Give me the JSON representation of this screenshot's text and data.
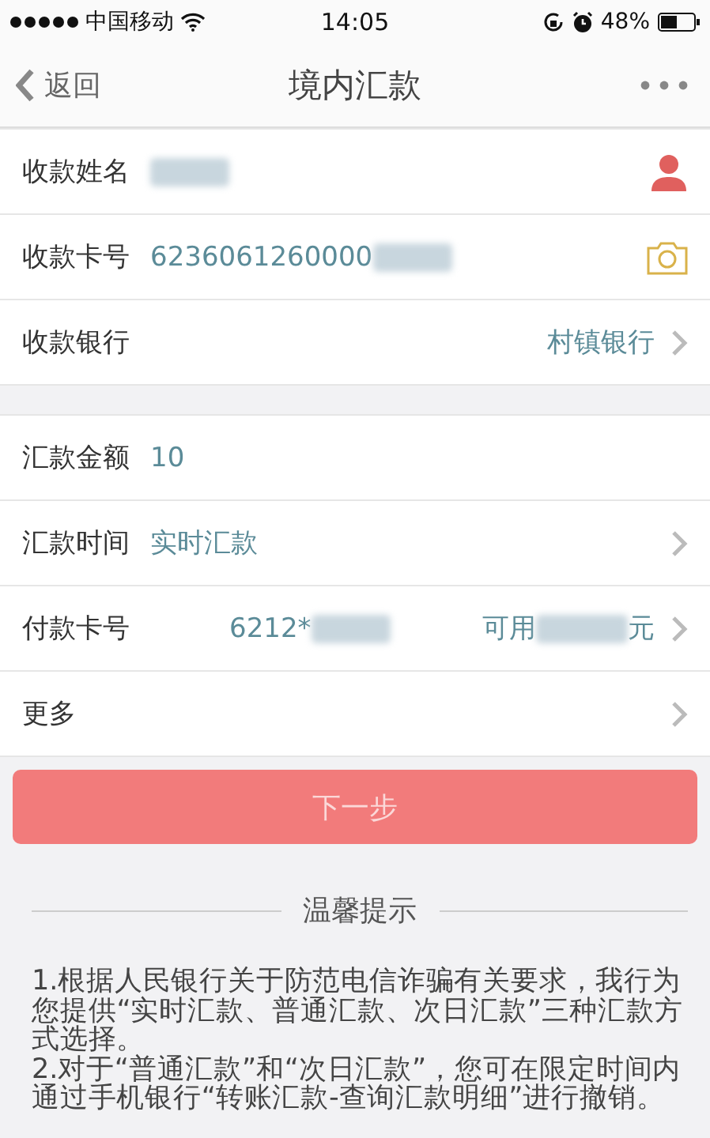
{
  "status_bar": {
    "carrier": "中国移动",
    "time": "14:05",
    "battery": "48%"
  },
  "nav": {
    "back": "返回",
    "title": "境内汇款"
  },
  "sections": [
    {
      "rows": [
        {
          "label": "收款姓名",
          "kind": "contact",
          "value": "",
          "redacted": true,
          "chevron": false
        },
        {
          "label": "收款卡号",
          "kind": "camera",
          "value": "6236061260000",
          "redacted": true,
          "chevron": false
        },
        {
          "label": "收款银行",
          "kind": "plain",
          "detail": "村镇银行",
          "chevron": true
        }
      ]
    },
    {
      "rows": [
        {
          "label": "汇款金额",
          "kind": "plain",
          "value": "10",
          "chevron": false
        },
        {
          "label": "汇款时间",
          "kind": "plain",
          "value": "实时汇款",
          "chevron": true
        },
        {
          "label": "付款卡号",
          "kind": "account",
          "value": "6212*",
          "redacted": true,
          "detail": "可用",
          "detail_redacted": true,
          "detail_suffix": "元",
          "chevron": true
        },
        {
          "label": "更多",
          "kind": "plain",
          "chevron": true
        }
      ]
    }
  ],
  "next_button": "下一步",
  "tips": {
    "title": "温馨提示",
    "items": [
      "1.根据人民银行关于防范电信诈骗有关要求，我行为您提供“实时汇款、普通汇款、次日汇款”三种汇款方式选择。",
      "2.对于“普通汇款”和“次日汇款”，您可在限定时间内通过手机银行“转账汇款-查询汇款明细”进行撤销。"
    ]
  }
}
